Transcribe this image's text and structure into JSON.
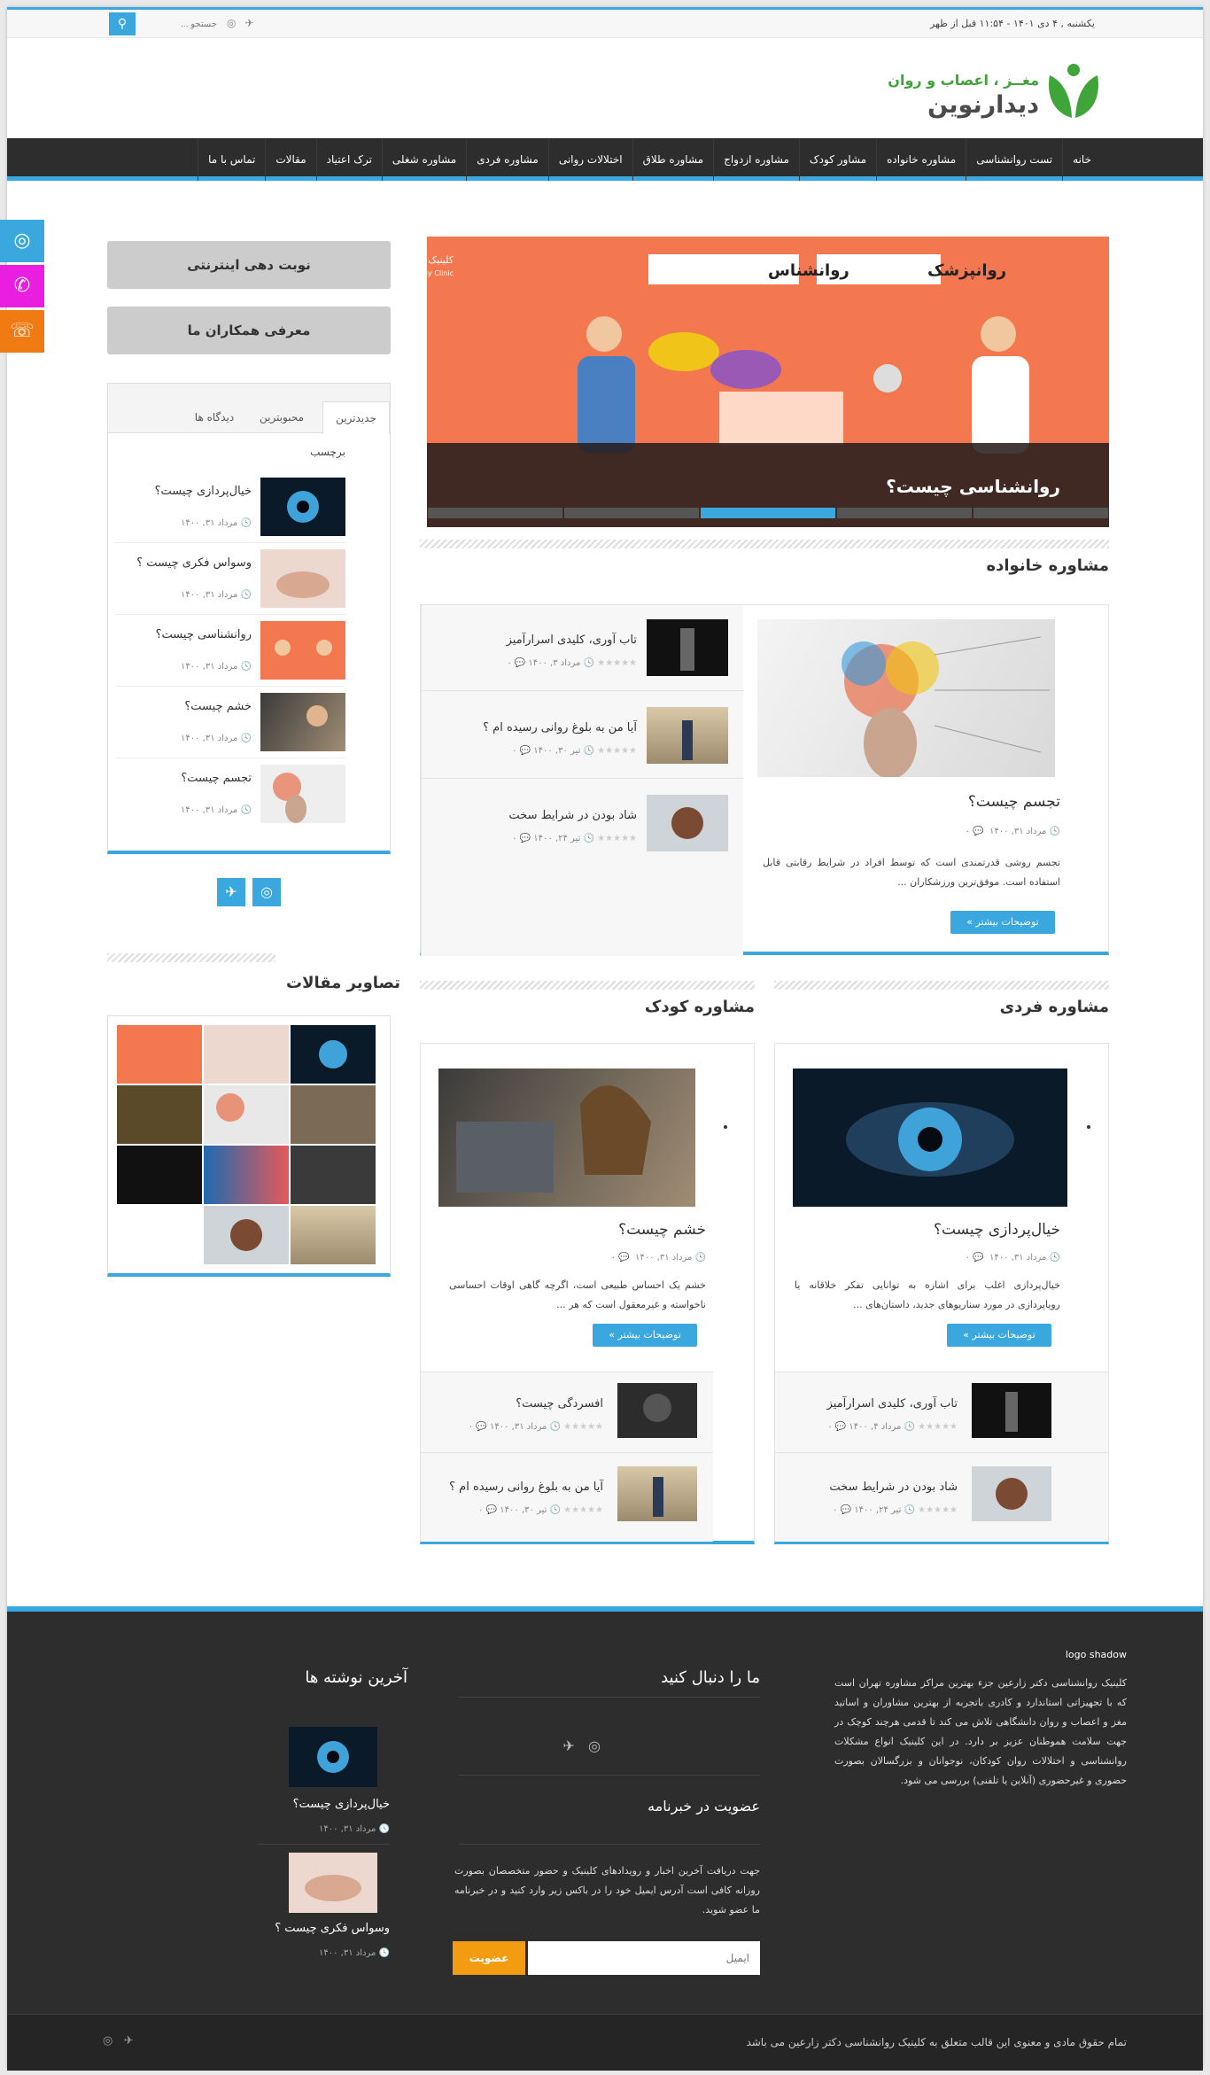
{
  "topbar": {
    "date": "یکشنبه , ۴ دی ۱۴۰۱ - ۱۱:۵۴ قبل از ظهر",
    "search_placeholder": "جستجو ...",
    "search_icon": "search-icon",
    "social": [
      "telegram-icon",
      "instagram-icon"
    ]
  },
  "logo": {
    "subtitle": "مغــز ، اعصاب و روان",
    "title": "دیدارنوین",
    "accent": "#3fa43a"
  },
  "nav": {
    "items": [
      "خانه",
      "تست روانشناسی",
      "مشاوره خانواده",
      "مشاور کودک",
      "مشاوره ازدواج",
      "مشاوره طلاق",
      "اختلالات روانی",
      "مشاوره فردی",
      "مشاوره شغلی",
      "ترک اعتیاد",
      "مقالات",
      "تماس با ما"
    ]
  },
  "colors": {
    "accent": "#3aa7df",
    "dark": "#2d2d2d",
    "whatsapp": "#e91ee0",
    "phone": "#f07b12",
    "subscribe": "#f39c12"
  },
  "float_icons": [
    "instagram-icon",
    "whatsapp-icon",
    "phone-icon"
  ],
  "slider": {
    "title": "روانشناسی چیست؟",
    "label_right": "روانپزشک",
    "label_left": "روانشناس",
    "clinic": "کلینیک روانشناسی دکتر زارعین",
    "clinic_en": "Dr. Zarein Psychology Clinic"
  },
  "family": {
    "heading": "مشاوره خانواده",
    "main": {
      "title": "تجسم چیست؟",
      "date": "مرداد ۳۱, ۱۴۰۰",
      "comments": "۰",
      "excerpt": "تجسم روشی قدرتمندی است که توسط افراد در شرایط رقابتی قابل استفاده است. موفق‌ترین ورزشکاران ...",
      "more": "توضیحات بیشتر »"
    },
    "list": [
      {
        "title": "تاب آوری، کلیدی اسرارآمیز",
        "date": "مرداد ۳, ۱۴۰۰",
        "comments": "۰"
      },
      {
        "title": "آیا من به بلوغ روانی رسیده ام ؟",
        "date": "تیر ۳۰, ۱۴۰۰",
        "comments": "۰"
      },
      {
        "title": "شاد بودن در شرایط سخت",
        "date": "تیر ۲۴, ۱۴۰۰",
        "comments": "۰"
      }
    ]
  },
  "individual": {
    "heading": "مشاوره فردی",
    "main": {
      "title": "خیال‌پردازی چیست؟",
      "date": "مرداد ۳۱, ۱۴۰۰",
      "comments": "۰",
      "excerpt": "خیال‌پردازی اغلب برای اشاره به توانایی تفکر خلاقانه یا رویاپردازی در مورد سناریوهای جدید، داستان‌های ...",
      "more": "توضیحات بیشتر »"
    },
    "list": [
      {
        "title": "تاب آوری، کلیدی اسرارآمیز",
        "date": "مرداد ۴, ۱۴۰۰",
        "comments": "۰"
      },
      {
        "title": "شاد بودن در شرایط سخت",
        "date": "تیر ۲۴, ۱۴۰۰",
        "comments": "۰"
      }
    ]
  },
  "child": {
    "heading": "مشاوره کودک",
    "main": {
      "title": "خشم چیست؟",
      "date": "مرداد ۳۱, ۱۴۰۰",
      "comments": "۰",
      "excerpt": "خشم یک احساس طبیعی است، اگرچه گاهی اوقات احساسی ناخواسته و غیرمعقول است که هر ...",
      "more": "توضیحات بیشتر »"
    },
    "list": [
      {
        "title": "افسردگی چیست؟",
        "date": "مرداد ۳۱, ۱۴۰۰",
        "comments": "۰"
      },
      {
        "title": "آیا من به بلوغ روانی رسیده ام ؟",
        "date": "تیر ۳۰, ۱۴۰۰",
        "comments": "۰"
      }
    ]
  },
  "sidebar": {
    "btn1": "نوبت دهی اینترنتی",
    "btn2": "معرفی همکاران ما",
    "tabs": [
      "جدیدترین",
      "محبوبترین",
      "دیدگاه ها"
    ],
    "tags": "برچسب",
    "posts": [
      {
        "title": "خیال‌پردازی چیست؟",
        "date": "مرداد ۳۱, ۱۴۰۰"
      },
      {
        "title": "وسواس فکری چیست ؟",
        "date": "مرداد ۳۱, ۱۴۰۰"
      },
      {
        "title": "روانشناسی چیست؟",
        "date": "مرداد ۳۱, ۱۴۰۰"
      },
      {
        "title": "خشم چیست؟",
        "date": "مرداد ۳۱, ۱۴۰۰"
      },
      {
        "title": "تجسم چیست؟",
        "date": "مرداد ۳۱, ۱۴۰۰"
      }
    ],
    "gallery_heading": "تصاویر مقالات"
  },
  "footer": {
    "logo_alt": "logo shadow",
    "about": "کلینیک روانشناسی دکتر زارعین جزء بهترین مراکز مشاوره تهران است که با تجهیزاتی استاندارد و کادری باتجربه از بهترین مشاوران و اساتید مغز و اعصاب و روان دانشگاهی تلاش می کند تا قدمی هرچند کوچک در جهت سلامت هموطنان عزیز بر دارد. در این کلینیک انواع مشکلات روانشناسی و اختلالات روان کودکان، نوجوانان و بزرگسالان بصورت حضوری و غیرحضوری (آنلاین یا تلفنی) بررسی می شود.",
    "follow": "ما را دنبال کنید",
    "newsletter": "عضویت در خبرنامه",
    "newsletter_text": "جهت دریافت آخرین اخبار و رویدادهای کلینیک و حضور متخصصان بصورت روزانه کافی است آدرس ایمیل خود را در باکس زیر وارد کنید و در خبرنامه ما عضو شوید.",
    "email_placeholder": "ایمیل",
    "subscribe": "عضویت",
    "latest": "آخرین نوشته ها",
    "latest_posts": [
      {
        "title": "خیال‌پردازی چیست؟",
        "date": "مرداد ۳۱, ۱۴۰۰"
      },
      {
        "title": "وسواس فکری چیست ؟",
        "date": "مرداد ۳۱, ۱۴۰۰"
      }
    ],
    "copyright": "تمام حقوق مادی و معنوی این قالب متعلق به کلینیک روانشناسی دکتر زارعین می باشد"
  }
}
